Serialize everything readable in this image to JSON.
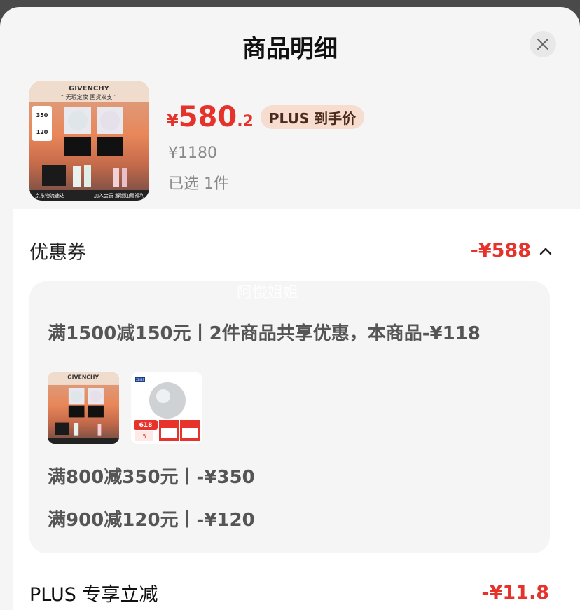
{
  "sheet": {
    "title": "商品明细"
  },
  "product": {
    "image_name": "givenchy-product-image",
    "image_text": {
      "brand": "GIVENCHY",
      "slogan": "“ 无瑕定妆 国货双支 ”",
      "badge_top": "350",
      "badge_bottom": "120",
      "footer_left": "京东物流速达",
      "footer_right": "加入会员  解锁加赠福利"
    },
    "price_symbol": "¥",
    "price_int": "580",
    "price_dec": ".2",
    "price_tag": "PLUS 到手价",
    "original_price": "¥1180",
    "selected_text": "已选 1件"
  },
  "coupon": {
    "label": "优惠券",
    "amount": "-¥588",
    "watermark": "阿慢姐姐",
    "rules": [
      "满1500减150元丨2件商品共享优惠，本商品-¥118",
      "满800减350元丨-¥350",
      "满900减120元丨-¥120"
    ],
    "second_item_text": {
      "brand": "ZEISS",
      "tag": "618",
      "tag2": "5"
    }
  },
  "plus_discount": {
    "label": "PLUS 专享立减",
    "amount": "-¥11.8"
  },
  "colors": {
    "accent_red": "#e5332b",
    "tag_bg": "#f7ddd0",
    "background": "#f5f5f5"
  }
}
